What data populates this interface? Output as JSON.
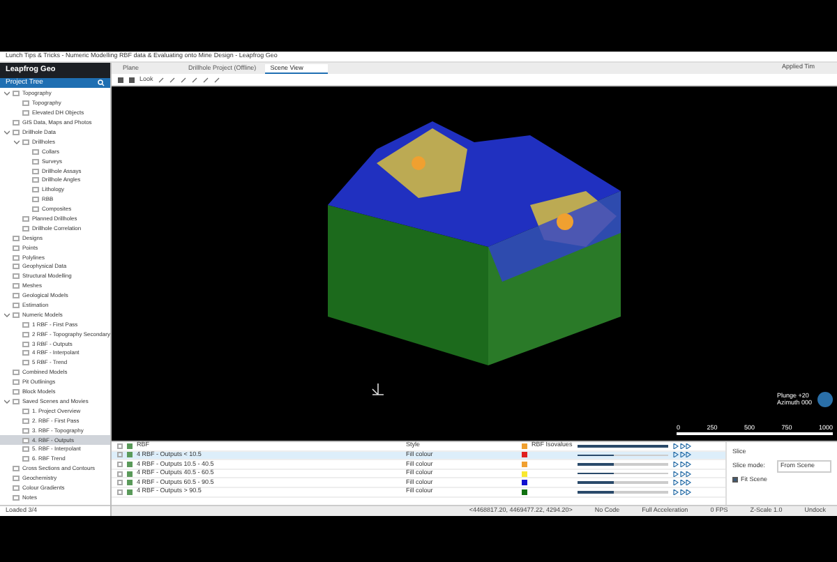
{
  "window": {
    "title": "Lunch Tips & Tricks - Numeric Modelling RBF data & Evaluating onto Mine Design - Leapfrog Geo"
  },
  "app": {
    "name": "Leapfrog Geo"
  },
  "tabs": [
    {
      "label": "Plane",
      "selected": false
    },
    {
      "label": "Drillhole Project (Offline)",
      "selected": false
    },
    {
      "label": "Scene View",
      "selected": true
    }
  ],
  "user": {
    "name": "Applied Tim"
  },
  "toolbar": {
    "label": "Look"
  },
  "project_tree": {
    "title": "Project Tree",
    "items": [
      {
        "label": "Topography",
        "expanded": true,
        "selected": false,
        "children": [
          {
            "label": "Topography",
            "selected": false
          },
          {
            "label": "Elevated DH Objects",
            "selected": false
          }
        ]
      },
      {
        "label": "GIS Data, Maps and Photos",
        "selected": false
      },
      {
        "label": "Drillhole Data",
        "expanded": true,
        "selected": false,
        "children": [
          {
            "label": "Drillholes",
            "expanded": true,
            "selected": false,
            "children": [
              {
                "label": "Collars",
                "selected": false
              },
              {
                "label": "Surveys",
                "selected": false
              },
              {
                "label": "Drillhole Assays",
                "selected": false
              },
              {
                "label": "Drillhole Angles",
                "selected": false
              },
              {
                "label": "Lithology",
                "selected": false
              },
              {
                "label": "RBB",
                "selected": false
              },
              {
                "label": "Composites",
                "selected": false
              }
            ]
          },
          {
            "label": "Planned Drillholes",
            "selected": false
          },
          {
            "label": "Drillhole Correlation",
            "selected": false
          }
        ]
      },
      {
        "label": "Designs",
        "selected": false
      },
      {
        "label": "Points",
        "selected": false
      },
      {
        "label": "Polylines",
        "selected": false
      },
      {
        "label": "Geophysical Data",
        "selected": false
      },
      {
        "label": "Structural Modelling",
        "selected": false
      },
      {
        "label": "Meshes",
        "selected": false
      },
      {
        "label": "Geological Models",
        "selected": false
      },
      {
        "label": "Estimation",
        "selected": false
      },
      {
        "label": "Numeric Models",
        "expanded": true,
        "selected": false,
        "children": [
          {
            "label": "1 RBF - First Pass",
            "selected": false
          },
          {
            "label": "2 RBF - Topography Secondary",
            "selected": false
          },
          {
            "label": "3 RBF - Outputs",
            "selected": false
          },
          {
            "label": "4 RBF - Interpolant",
            "selected": false
          },
          {
            "label": "5 RBF - Trend",
            "selected": false
          }
        ]
      },
      {
        "label": "Combined Models",
        "selected": false
      },
      {
        "label": "Pit Outlinings",
        "selected": false
      },
      {
        "label": "Block Models",
        "selected": false
      },
      {
        "label": "Saved Scenes and Movies",
        "expanded": true,
        "selected": false,
        "children": [
          {
            "label": "1. Project Overview",
            "selected": false
          },
          {
            "label": "2. RBF - First Pass",
            "selected": false
          },
          {
            "label": "3. RBF - Topography",
            "selected": false
          },
          {
            "label": "4. RBF - Outputs",
            "selected": true
          },
          {
            "label": "5. RBF - Interpolant",
            "selected": false
          },
          {
            "label": "6. RBF Trend",
            "selected": false
          }
        ]
      },
      {
        "label": "Cross Sections and Contours",
        "selected": false
      },
      {
        "label": "Geochemistry",
        "selected": false
      },
      {
        "label": "Colour Gradients",
        "selected": false
      },
      {
        "label": "Notes",
        "selected": false
      }
    ]
  },
  "tree_status": "Loaded 3/4",
  "viewer": {
    "plunge": "Plunge +20",
    "azimuth": "Azimuth 000",
    "scale_ticks": [
      "0",
      "250",
      "500",
      "750",
      "1000"
    ]
  },
  "shown_list": {
    "rows": [
      {
        "name": "RBF",
        "style": "Style",
        "swatch_label": "RBF Isovalues",
        "color": "#f0a030",
        "level": 1.0,
        "selected": false
      },
      {
        "name": "4 RBF - Outputs < 10.5",
        "style": "Fill colour",
        "color": "#e02020",
        "level": 0.4,
        "selected": true
      },
      {
        "name": "4 RBF - Outputs 10.5 - 40.5",
        "style": "Fill colour",
        "color": "#f0a030",
        "level": 0.4,
        "selected": false
      },
      {
        "name": "4 RBF - Outputs 40.5 - 60.5",
        "style": "Fill colour",
        "color": "#f8e830",
        "level": 0.4,
        "selected": false
      },
      {
        "name": "4 RBF - Outputs 60.5 - 90.5",
        "style": "Fill colour",
        "color": "#1010d0",
        "level": 0.4,
        "selected": false
      },
      {
        "name": "4 RBF - Outputs > 90.5",
        "style": "Fill colour",
        "color": "#107010",
        "level": 0.4,
        "selected": false
      }
    ]
  },
  "properties": {
    "slice": "Slice",
    "slice_mode_label": "Slice mode:",
    "slice_mode_value": "From Scene",
    "fit_label": "Fit Scene",
    "fit_checked": true
  },
  "status_bar": [
    "<4468817.20, 4469477.22, 4294.20>",
    "No Code",
    "Full Acceleration",
    "0 FPS",
    "Z-Scale 1.0",
    "Undock"
  ]
}
